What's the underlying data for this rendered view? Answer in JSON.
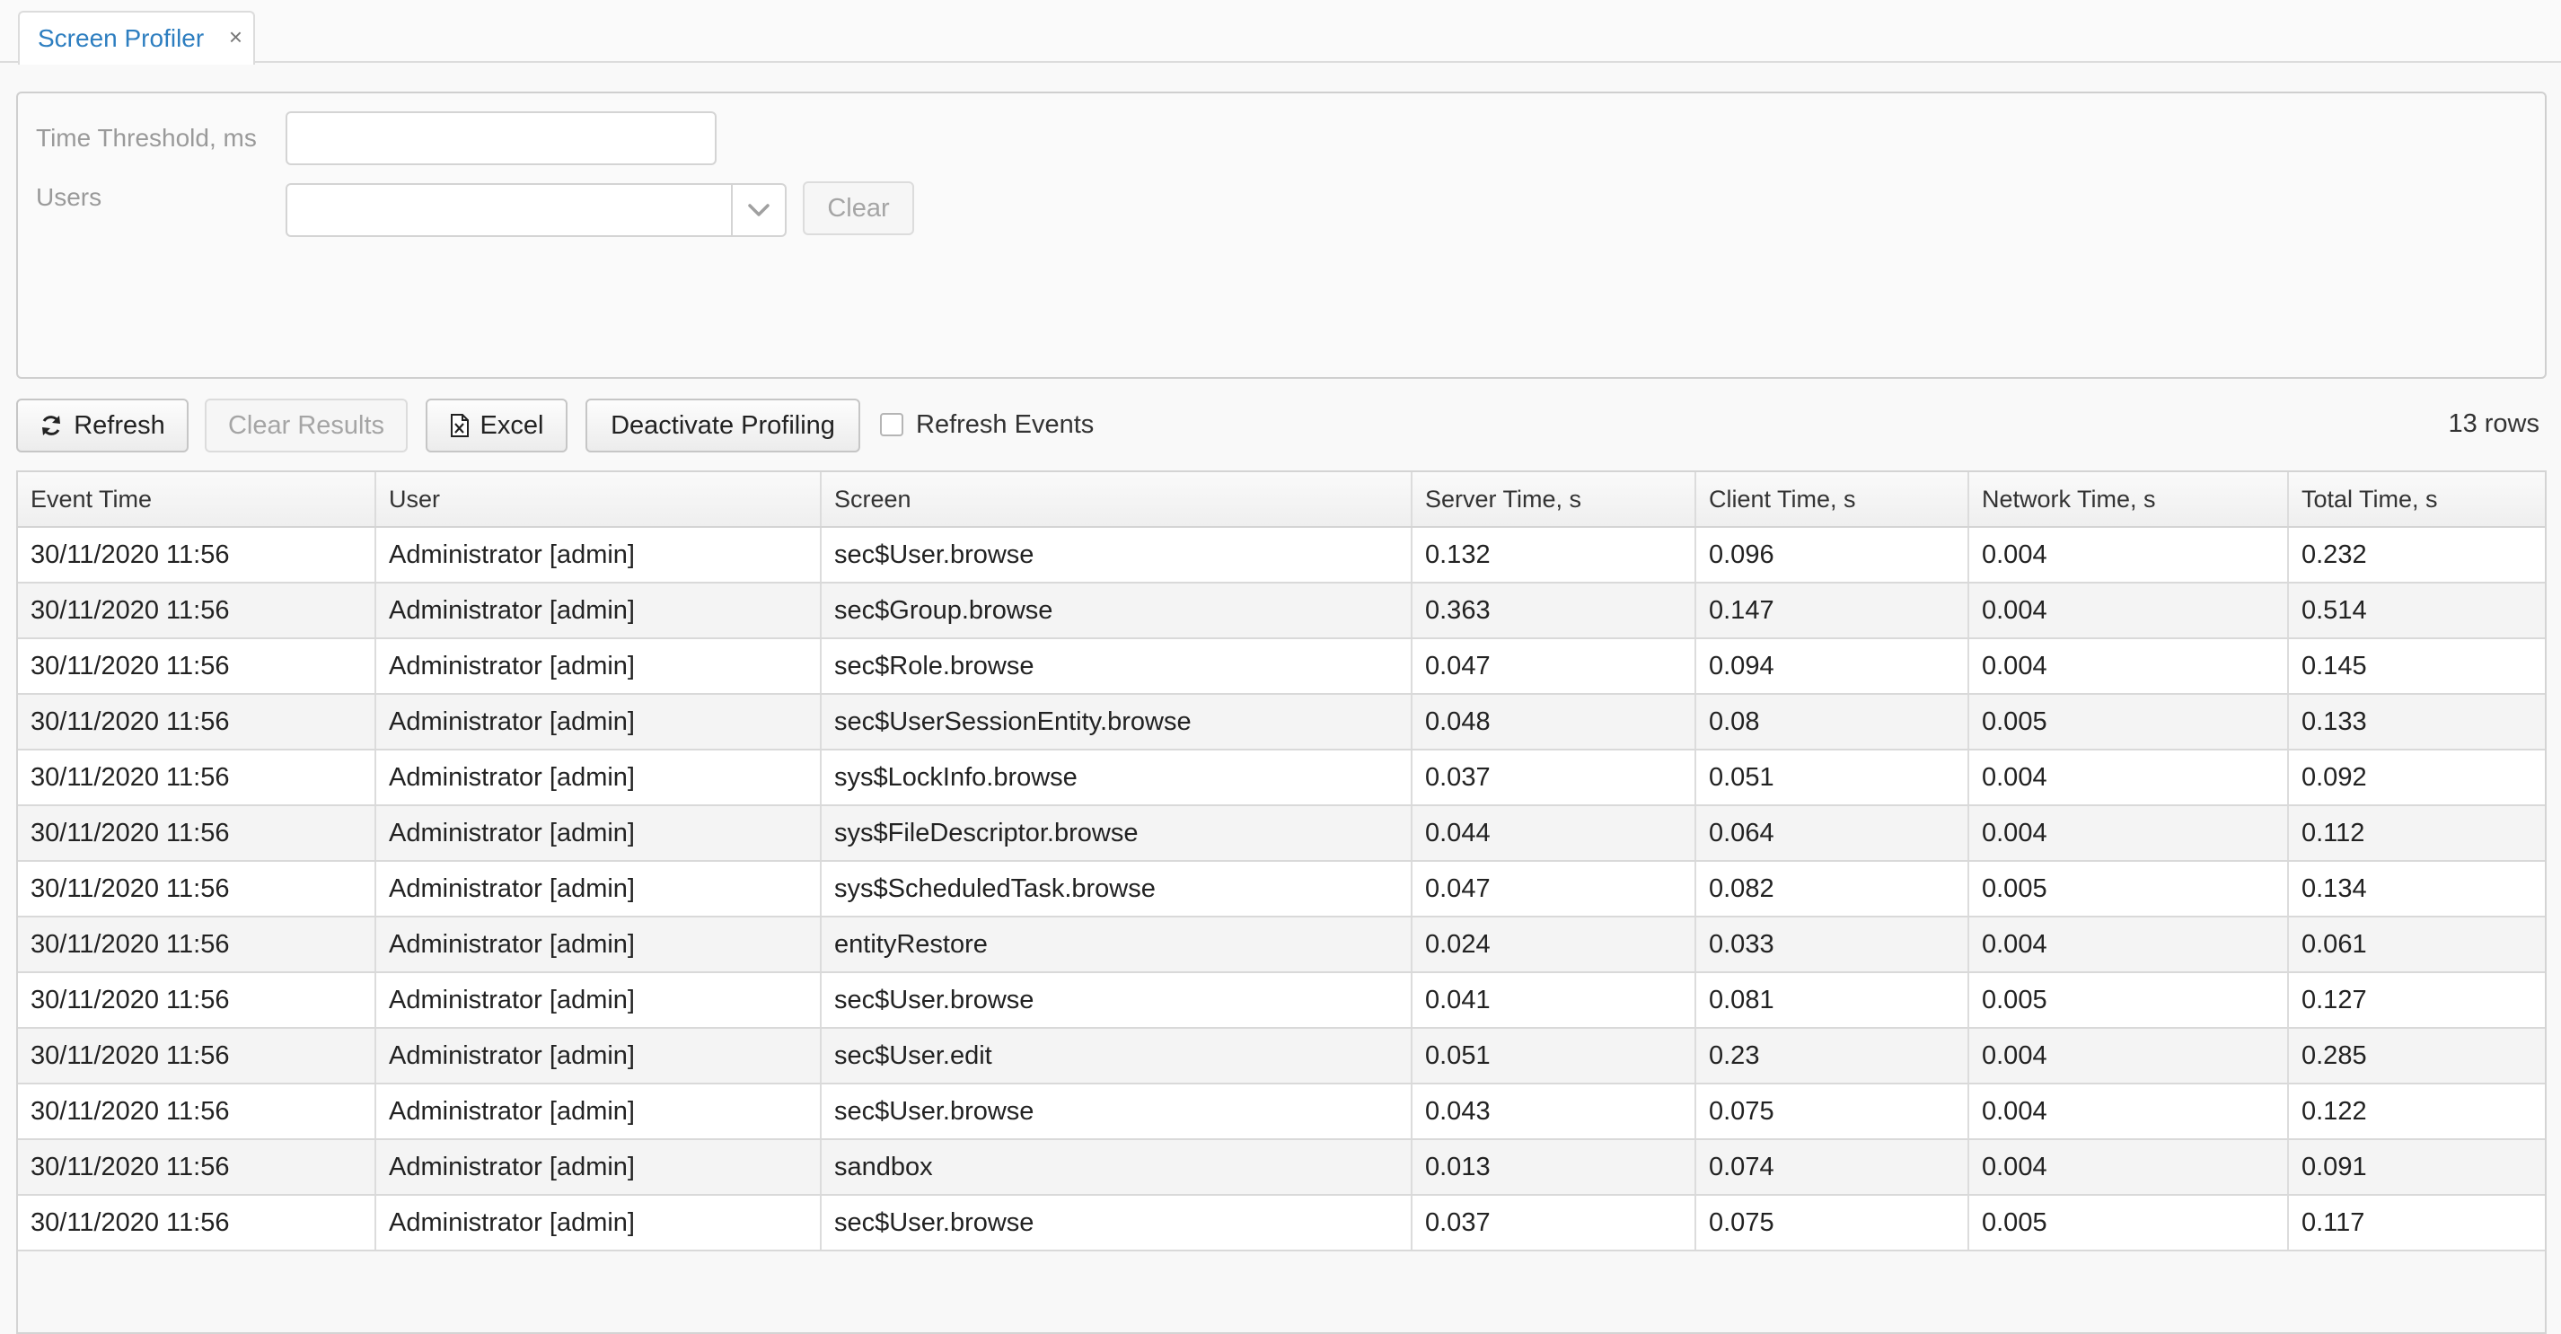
{
  "tabs": [
    {
      "label": "Screen Profiler",
      "close": "×"
    }
  ],
  "filter": {
    "threshold_label": "Time Threshold, ms",
    "threshold_value": "",
    "users_label": "Users",
    "users_value": "",
    "clear_label": "Clear"
  },
  "toolbar": {
    "refresh_label": "Refresh",
    "clear_results_label": "Clear Results",
    "excel_label": "Excel",
    "deactivate_label": "Deactivate Profiling",
    "refresh_events_label": "Refresh Events",
    "refresh_events_checked": false,
    "rows_count": "13 rows"
  },
  "table": {
    "columns": [
      "Event Time",
      "User",
      "Screen",
      "Server Time, s",
      "Client Time, s",
      "Network Time, s",
      "Total Time, s"
    ],
    "rows": [
      [
        "30/11/2020 11:56",
        "Administrator [admin]",
        "sec$User.browse",
        "0.132",
        "0.096",
        "0.004",
        "0.232"
      ],
      [
        "30/11/2020 11:56",
        "Administrator [admin]",
        "sec$Group.browse",
        "0.363",
        "0.147",
        "0.004",
        "0.514"
      ],
      [
        "30/11/2020 11:56",
        "Administrator [admin]",
        "sec$Role.browse",
        "0.047",
        "0.094",
        "0.004",
        "0.145"
      ],
      [
        "30/11/2020 11:56",
        "Administrator [admin]",
        "sec$UserSessionEntity.browse",
        "0.048",
        "0.08",
        "0.005",
        "0.133"
      ],
      [
        "30/11/2020 11:56",
        "Administrator [admin]",
        "sys$LockInfo.browse",
        "0.037",
        "0.051",
        "0.004",
        "0.092"
      ],
      [
        "30/11/2020 11:56",
        "Administrator [admin]",
        "sys$FileDescriptor.browse",
        "0.044",
        "0.064",
        "0.004",
        "0.112"
      ],
      [
        "30/11/2020 11:56",
        "Administrator [admin]",
        "sys$ScheduledTask.browse",
        "0.047",
        "0.082",
        "0.005",
        "0.134"
      ],
      [
        "30/11/2020 11:56",
        "Administrator [admin]",
        "entityRestore",
        "0.024",
        "0.033",
        "0.004",
        "0.061"
      ],
      [
        "30/11/2020 11:56",
        "Administrator [admin]",
        "sec$User.browse",
        "0.041",
        "0.081",
        "0.005",
        "0.127"
      ],
      [
        "30/11/2020 11:56",
        "Administrator [admin]",
        "sec$User.edit",
        "0.051",
        "0.23",
        "0.004",
        "0.285"
      ],
      [
        "30/11/2020 11:56",
        "Administrator [admin]",
        "sec$User.browse",
        "0.043",
        "0.075",
        "0.004",
        "0.122"
      ],
      [
        "30/11/2020 11:56",
        "Administrator [admin]",
        "sandbox",
        "0.013",
        "0.074",
        "0.004",
        "0.091"
      ],
      [
        "30/11/2020 11:56",
        "Administrator [admin]",
        "sec$User.browse",
        "0.037",
        "0.075",
        "0.005",
        "0.117"
      ]
    ]
  },
  "icons": {
    "refresh": "refresh-icon",
    "excel": "excel-file-icon",
    "dropdown": "chevron-down-icon",
    "close": "close-icon"
  },
  "colors": {
    "tab_label": "#2d7ec0",
    "disabled_text": "#a5a5a5"
  }
}
